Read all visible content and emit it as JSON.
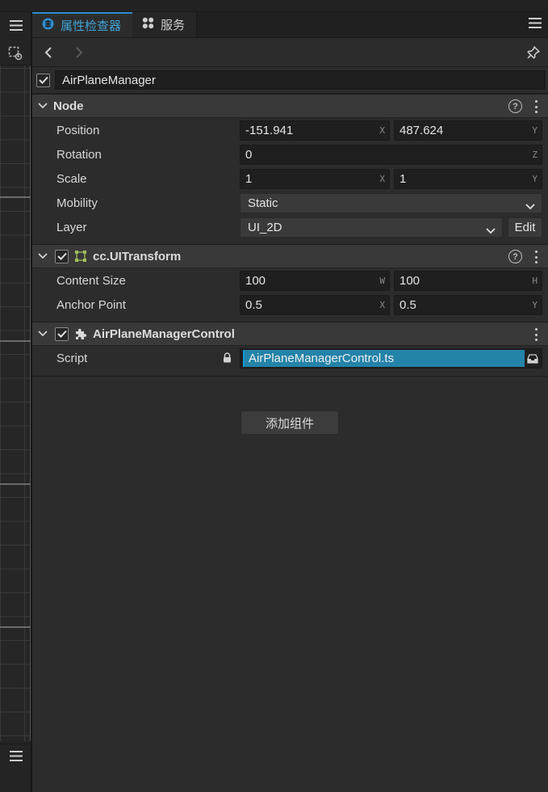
{
  "left_panel": {
    "menu_icon": "hamburger-icon",
    "tool_icon": "scene-gizmo-icon",
    "bottom_menu_icon": "hamburger-icon"
  },
  "tabs": [
    {
      "label": "属性检查器",
      "icon": "inspector-icon",
      "active": true
    },
    {
      "label": "服务",
      "icon": "services-icon",
      "active": false
    }
  ],
  "node": {
    "enabled": true,
    "name": "AirPlaneManager"
  },
  "node_section": {
    "title": "Node",
    "position": {
      "label": "Position",
      "x": "-151.941",
      "x_axis": "X",
      "y": "487.624",
      "y_axis": "Y"
    },
    "rotation": {
      "label": "Rotation",
      "value": "0",
      "axis": "Z"
    },
    "scale": {
      "label": "Scale",
      "x": "1",
      "x_axis": "X",
      "y": "1",
      "y_axis": "Y"
    },
    "mobility": {
      "label": "Mobility",
      "value": "Static"
    },
    "layer": {
      "label": "Layer",
      "value": "UI_2D",
      "edit_label": "Edit"
    }
  },
  "uitransform_section": {
    "title": "cc.UITransform",
    "enabled": true,
    "content_size": {
      "label": "Content Size",
      "w": "100",
      "w_axis": "W",
      "h": "100",
      "h_axis": "H"
    },
    "anchor_point": {
      "label": "Anchor Point",
      "x": "0.5",
      "x_axis": "X",
      "y": "0.5",
      "y_axis": "Y"
    }
  },
  "script_section": {
    "title": "AirPlaneManagerControl",
    "enabled": true,
    "script": {
      "label": "Script",
      "value": "AirPlaneManagerControl.ts"
    }
  },
  "add_component_label": "添加组件",
  "colors": {
    "accent": "#3fa3d8",
    "selection": "#2383a8",
    "panel_bg": "#2c2c2c",
    "section_header_bg": "#393939",
    "field_bg": "#1f1f1f"
  }
}
